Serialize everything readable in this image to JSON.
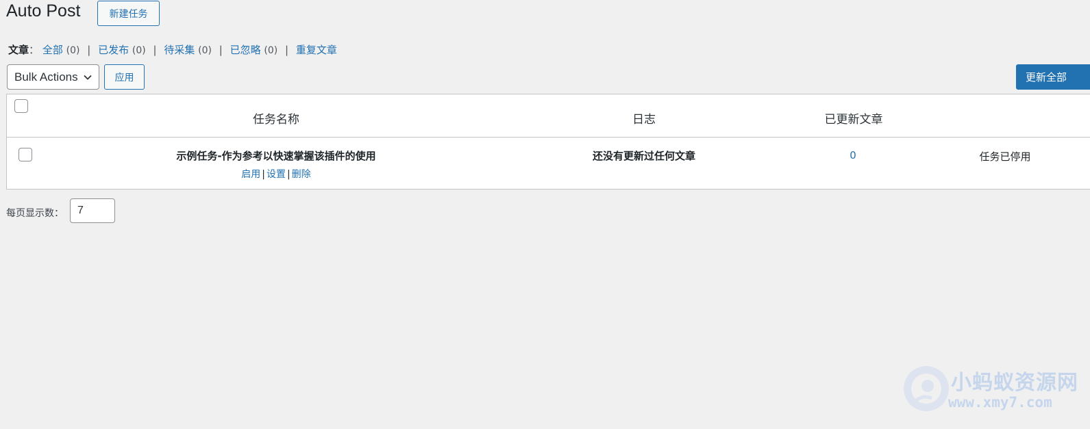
{
  "header": {
    "title": "Auto Post",
    "new_task_label": "新建任务"
  },
  "filters": {
    "label": "文章",
    "colon": "：",
    "items": [
      {
        "label": "全部",
        "count": "(0)"
      },
      {
        "label": "已发布",
        "count": "(0)"
      },
      {
        "label": "待采集",
        "count": "(0)"
      },
      {
        "label": "已忽略",
        "count": "(0)"
      },
      {
        "label": "重复文章",
        "count": ""
      }
    ],
    "separator": "|"
  },
  "toolbar": {
    "bulk_actions_value": "Bulk Actions",
    "apply_label": "应用",
    "update_all_label": "更新全部"
  },
  "table": {
    "columns": [
      "任务名称",
      "日志",
      "已更新文章",
      ""
    ],
    "rows": [
      {
        "task_name": "示例任务-作为参考以快速掌握该插件的使用",
        "actions": [
          "启用",
          "设置",
          "删除"
        ],
        "log": "还没有更新过任何文章",
        "updated_count": "0",
        "status": "任务已停用"
      }
    ]
  },
  "per_page": {
    "label": "每页显示数：",
    "value": "7"
  },
  "watermark": {
    "title": "小蚂蚁资源网",
    "url": "www.xmy7.com"
  },
  "colors": {
    "background": "#f0f0f1",
    "accent": "#2271b1",
    "border": "#c3c4c7"
  }
}
